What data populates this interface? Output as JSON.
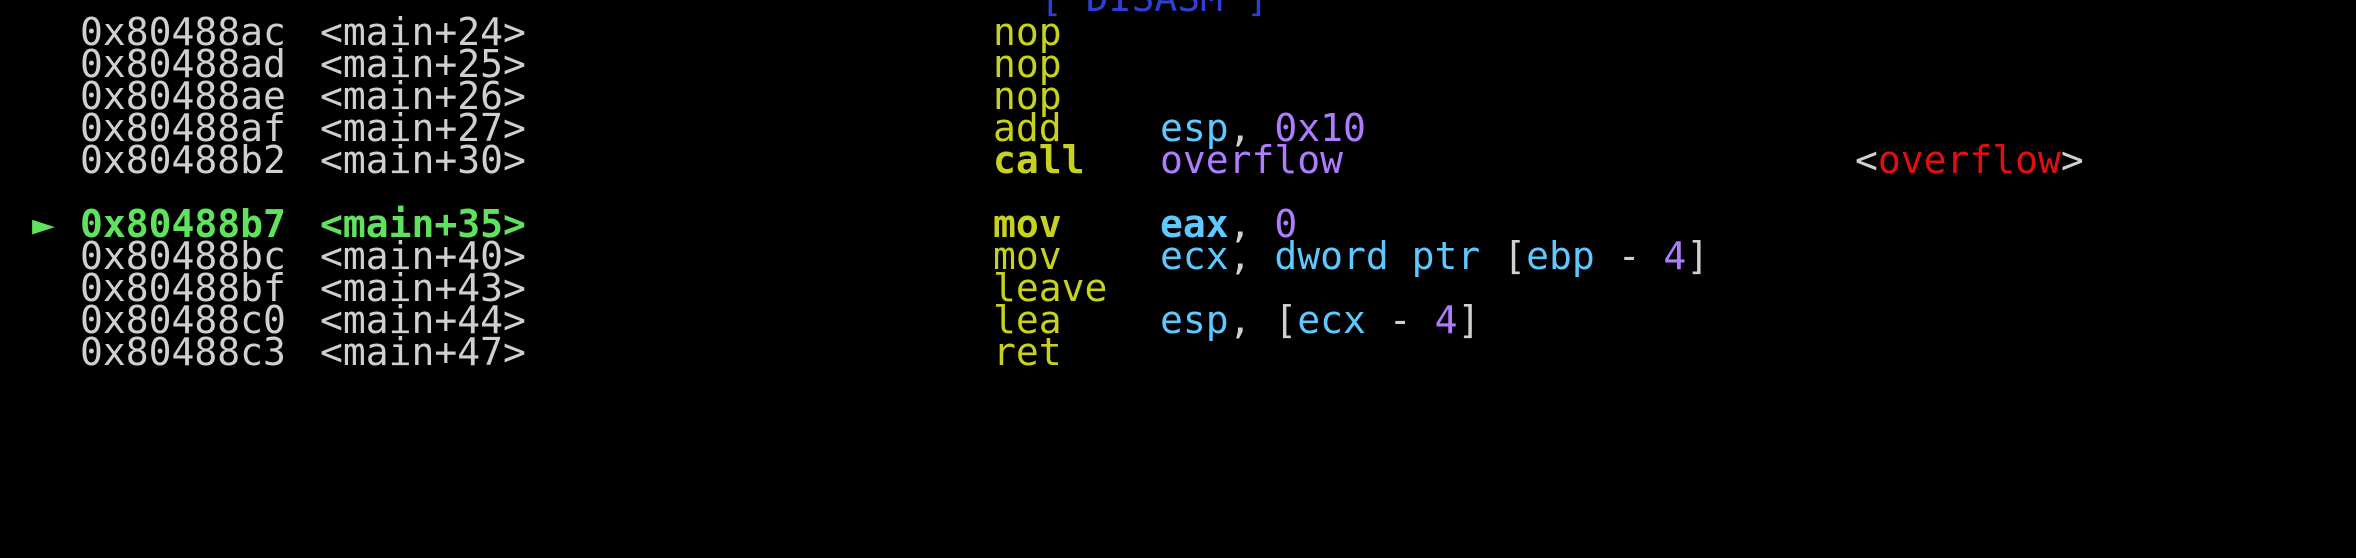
{
  "panel": {
    "header": "[ DISASM ]"
  },
  "colors": {
    "background": "#000000",
    "address": "#d0d0d0",
    "current": "#5fe35f",
    "mnemonic": "#c8d21e",
    "register": "#5fc8ff",
    "number": "#b07cff",
    "symbol_ref": "#b07cff",
    "annotation_target": "#e01010",
    "header": "#2f3fd6"
  },
  "lines": [
    {
      "arrow": "",
      "addr": "0x80488ac",
      "sym": "<main+24>",
      "mnemonic": "nop",
      "tokens": []
    },
    {
      "arrow": "",
      "addr": "0x80488ad",
      "sym": "<main+25>",
      "mnemonic": "nop",
      "tokens": []
    },
    {
      "arrow": "",
      "addr": "0x80488ae",
      "sym": "<main+26>",
      "mnemonic": "nop",
      "tokens": []
    },
    {
      "arrow": "",
      "addr": "0x80488af",
      "sym": "<main+27>",
      "mnemonic": "add",
      "tokens": [
        {
          "t": "esp",
          "k": "reg"
        },
        {
          "t": ", ",
          "k": "punc"
        },
        {
          "t": "0x10",
          "k": "num"
        }
      ]
    },
    {
      "arrow": "",
      "addr": "0x80488b2",
      "sym": "<main+30>",
      "mnemonic": "call",
      "bold": true,
      "tokens": [
        {
          "t": "overflow",
          "k": "symref"
        }
      ],
      "annotation": {
        "open": "<",
        "target": "overflow",
        "close": ">"
      }
    },
    {
      "blank": true
    },
    {
      "arrow": "►",
      "addr": "0x80488b7",
      "sym": "<main+35>",
      "mnemonic": "mov",
      "current": true,
      "tokens": [
        {
          "t": "eax",
          "k": "reg"
        },
        {
          "t": ", ",
          "k": "punc"
        },
        {
          "t": "0",
          "k": "num"
        }
      ]
    },
    {
      "arrow": "",
      "addr": "0x80488bc",
      "sym": "<main+40>",
      "mnemonic": "mov",
      "tokens": [
        {
          "t": "ecx",
          "k": "reg"
        },
        {
          "t": ", ",
          "k": "punc"
        },
        {
          "t": "dword ptr",
          "k": "reg"
        },
        {
          "t": " [",
          "k": "punc"
        },
        {
          "t": "ebp",
          "k": "reg"
        },
        {
          "t": " - ",
          "k": "punc"
        },
        {
          "t": "4",
          "k": "num"
        },
        {
          "t": "]",
          "k": "punc"
        }
      ]
    },
    {
      "arrow": "",
      "addr": "0x80488bf",
      "sym": "<main+43>",
      "mnemonic": "leave",
      "tokens": []
    },
    {
      "arrow": "",
      "addr": "0x80488c0",
      "sym": "<main+44>",
      "mnemonic": "lea",
      "tokens": [
        {
          "t": "esp",
          "k": "reg"
        },
        {
          "t": ", [",
          "k": "punc"
        },
        {
          "t": "ecx",
          "k": "reg"
        },
        {
          "t": " - ",
          "k": "punc"
        },
        {
          "t": "4",
          "k": "num"
        },
        {
          "t": "]",
          "k": "punc"
        }
      ]
    },
    {
      "arrow": "",
      "addr": "0x80488c3",
      "sym": "<main+47>",
      "mnemonic": "ret",
      "tokens": []
    }
  ]
}
